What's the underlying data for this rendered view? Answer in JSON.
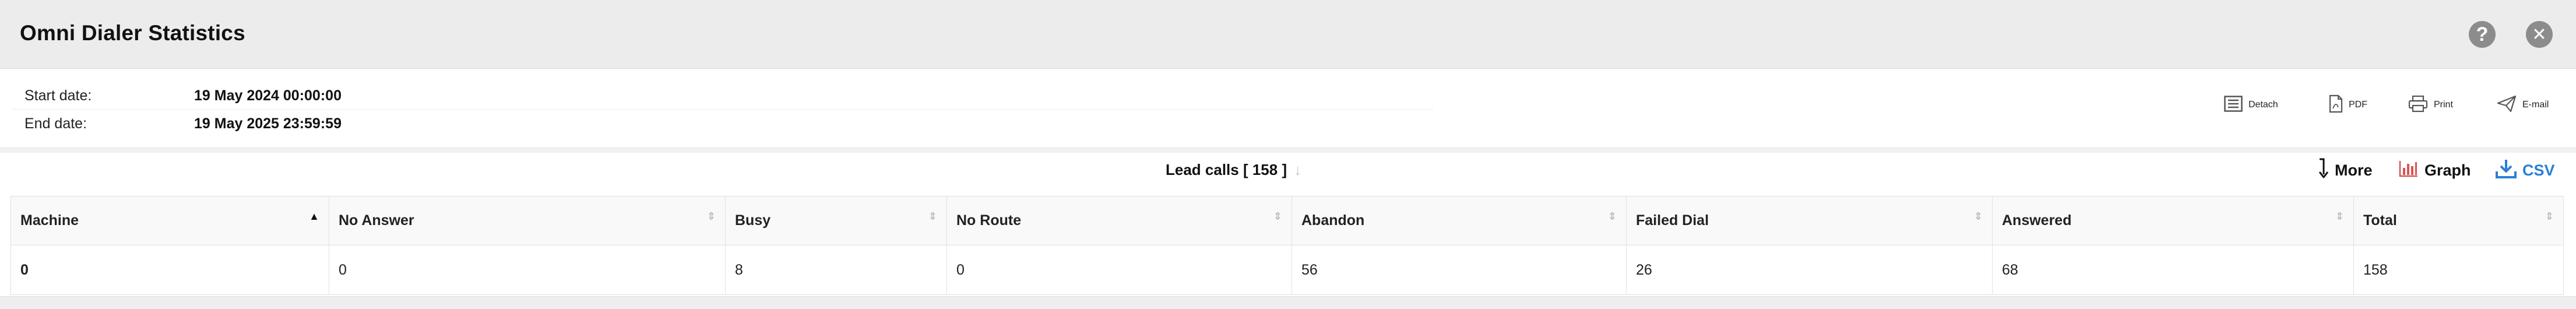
{
  "window": {
    "title": "Omni Dialer Statistics"
  },
  "titlebar_icons": {
    "help": "question-icon",
    "close": "close-icon"
  },
  "dates": {
    "start_label": "Start date:",
    "start_value": "19 May 2024 00:00:00",
    "end_label": "End date:",
    "end_value": "19 May 2025 23:59:59"
  },
  "actions": {
    "detach": "Detach",
    "pdf": "PDF",
    "print": "Print",
    "email": "E-mail"
  },
  "lead": {
    "label": "Lead calls [ 158 ]"
  },
  "tools": {
    "more": "More",
    "graph": "Graph",
    "csv": "CSV"
  },
  "colors": {
    "csv_accent": "#2a7fd4",
    "graph_accent": "#d9534f",
    "titlebar_bg": "#ececec"
  },
  "table": {
    "columns": [
      "Machine",
      "No Answer",
      "Busy",
      "No Route",
      "Abandon",
      "Failed Dial",
      "Answered",
      "Total"
    ],
    "sorted_column": "Machine",
    "sort_direction": "ascending",
    "rows": [
      [
        "0",
        "0",
        "8",
        "0",
        "56",
        "26",
        "68",
        "158"
      ]
    ]
  }
}
